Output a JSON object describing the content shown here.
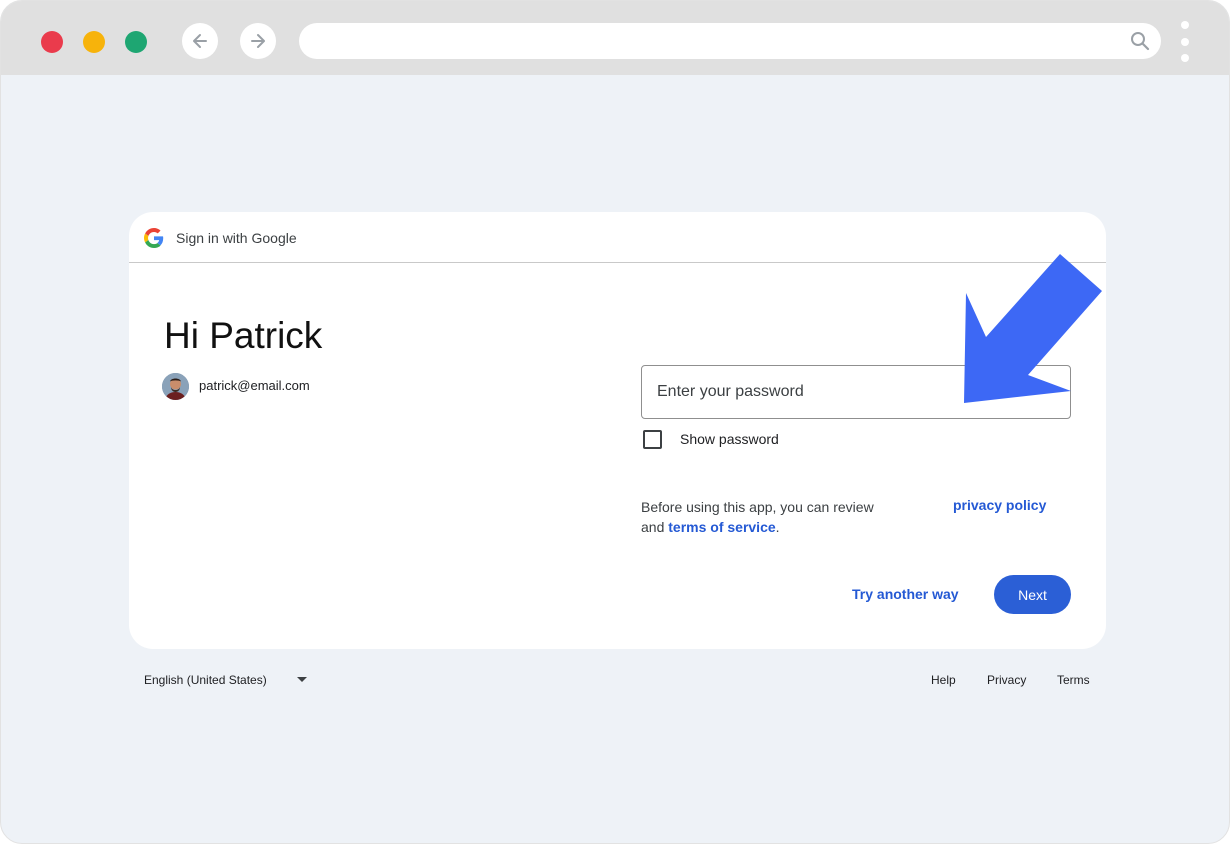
{
  "colors": {
    "window_bg": "#eef2f7",
    "titlebar_bg": "#e0e0e0",
    "traffic_red": "#ea3b4c",
    "traffic_yellow": "#f7b30b",
    "traffic_green": "#1ea672",
    "link_blue": "#2459d4",
    "button_blue": "#2b5fd6",
    "arrow_blue": "#3d68f5"
  },
  "browser": {
    "traffic_lights": [
      "close",
      "minimize",
      "maximize"
    ],
    "back_icon": "arrow-left-icon",
    "forward_icon": "arrow-right-icon",
    "url": "",
    "search_icon": "search-icon",
    "menu_icon": "kebab-menu-icon"
  },
  "card": {
    "header_title": "Sign in with Google",
    "greeting": "Hi Patrick",
    "email": "patrick@email.com",
    "password_placeholder": "Enter your password",
    "show_password_label": "Show password",
    "show_password_checked": false,
    "notice_line1": "Before using this app, you can review",
    "notice_and": "and",
    "terms_link": "terms of service",
    "notice_period": ".",
    "privacy_link": "privacy policy",
    "try_another_label": "Try another way",
    "next_label": "Next"
  },
  "footer": {
    "language": "English (United States)",
    "links": [
      "Help",
      "Privacy",
      "Terms"
    ]
  }
}
